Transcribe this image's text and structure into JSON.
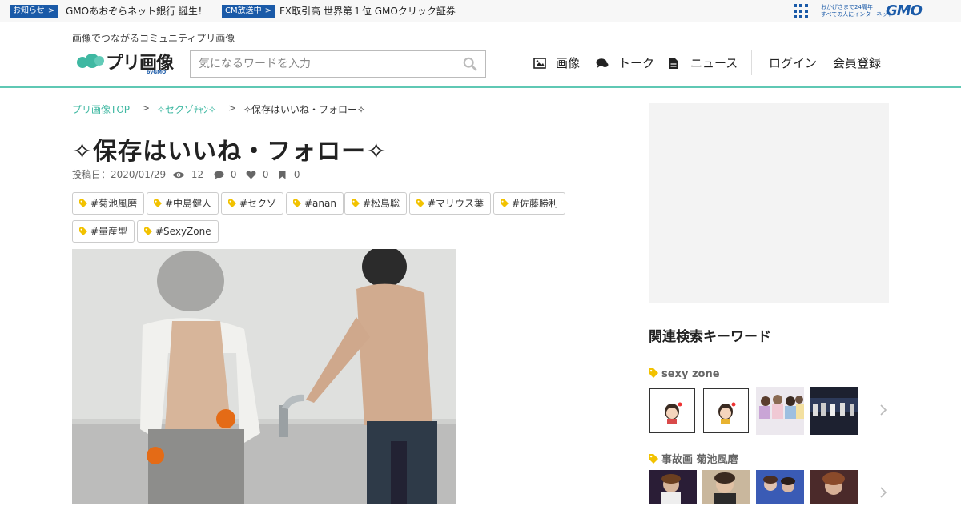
{
  "topbar": {
    "notice_badge": "お知らせ",
    "notice_arrow": ">",
    "notice_text": "GMOあおぞらネット銀行 誕生！",
    "cm_badge": "CM放送中",
    "cm_arrow": ">",
    "cm_text": "FX取引高 世界第１位 GMOクリック証券",
    "gmo_tagline_1": "おかげさまで24周年",
    "gmo_tagline_2": "すべての人にインターネット",
    "gmo_logo": "GMO"
  },
  "header": {
    "tagline": "画像でつながるコミュニティプリ画像",
    "logo_text": "プリ画像",
    "logo_by": "byGMO",
    "search_placeholder": "気になるワードを入力",
    "nav": [
      {
        "label": "画像",
        "icon": "image-icon"
      },
      {
        "label": "トーク",
        "icon": "chat-icon"
      },
      {
        "label": "ニュース",
        "icon": "document-icon"
      }
    ],
    "login": "ログイン",
    "register": "会員登録"
  },
  "breadcrumb": {
    "home": "プリ画像TOP",
    "sep": ">",
    "category": "✧セクゾﾁｬﾝ✧",
    "current": "✧保存はいいね・フォロー✧"
  },
  "post": {
    "title": "✧保存はいいね・フォロー✧",
    "date_label": "投稿日：2020/01/29",
    "views": "12",
    "comments": "0",
    "likes": "0",
    "bookmarks": "0",
    "tags": [
      "#菊池風磨",
      "#中島健人",
      "#セクゾ",
      "#anan",
      "#松島聡",
      "#マリウス葉",
      "#佐藤勝利",
      "#量産型",
      "#SexyZone"
    ]
  },
  "sidebar": {
    "heading": "関連検索キーワード",
    "keywords": [
      {
        "label": "sexy zone"
      },
      {
        "label": "事故画 菊池風磨"
      }
    ]
  },
  "colors": {
    "accent": "#3fb8a2",
    "gmo_blue": "#1a5aa8",
    "tag_yellow": "#f2c200"
  }
}
